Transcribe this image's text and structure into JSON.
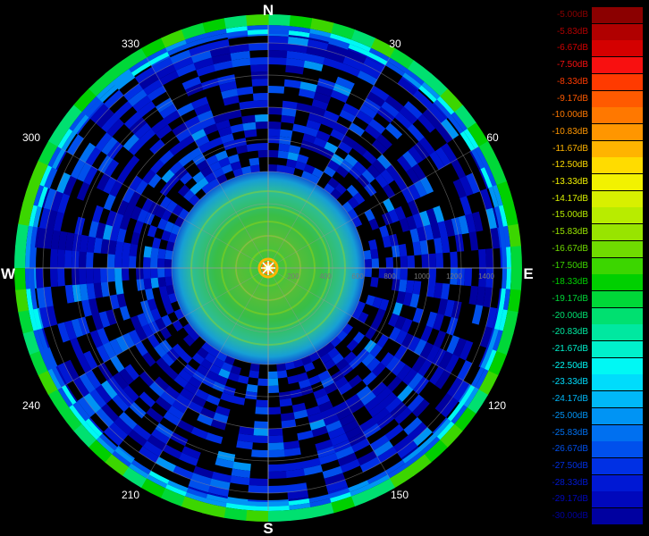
{
  "compass": {
    "north": "N",
    "south": "S",
    "east": "E",
    "west": "W"
  },
  "bearings": [
    "30",
    "60",
    "120",
    "150",
    "210",
    "240",
    "300",
    "330"
  ],
  "range_labels": [
    "200",
    "400",
    "600",
    "800",
    "1000",
    "1200",
    "1400"
  ],
  "colors": {
    "background": "#000000",
    "grid": "#9a9a9a",
    "range_label": "#7a7a7a"
  },
  "legend": {
    "items": [
      {
        "label": "-5.00dB",
        "color": "#8b0000"
      },
      {
        "label": "-5.83dB",
        "color": "#b00000"
      },
      {
        "label": "-6.67dB",
        "color": "#d40000"
      },
      {
        "label": "-7.50dB",
        "color": "#f81010"
      },
      {
        "label": "-8.33dB",
        "color": "#ff3a00"
      },
      {
        "label": "-9.17dB",
        "color": "#ff5a00"
      },
      {
        "label": "-10.00dB",
        "color": "#ff7800"
      },
      {
        "label": "-10.83dB",
        "color": "#ff9600"
      },
      {
        "label": "-11.67dB",
        "color": "#ffb400"
      },
      {
        "label": "-12.50dB",
        "color": "#ffdc00"
      },
      {
        "label": "-13.33dB",
        "color": "#f2f200"
      },
      {
        "label": "-14.17dB",
        "color": "#d8f000"
      },
      {
        "label": "-15.00dB",
        "color": "#b8ec00"
      },
      {
        "label": "-15.83dB",
        "color": "#98e400"
      },
      {
        "label": "-16.67dB",
        "color": "#70dc00"
      },
      {
        "label": "-17.50dB",
        "color": "#3cd600"
      },
      {
        "label": "-18.33dB",
        "color": "#00d000"
      },
      {
        "label": "-19.17dB",
        "color": "#00d838"
      },
      {
        "label": "-20.00dB",
        "color": "#00e070"
      },
      {
        "label": "-20.83dB",
        "color": "#00e8a0"
      },
      {
        "label": "-21.67dB",
        "color": "#00f0cc"
      },
      {
        "label": "-22.50dB",
        "color": "#00f8f4"
      },
      {
        "label": "-23.33dB",
        "color": "#00dcfc"
      },
      {
        "label": "-24.17dB",
        "color": "#00b8f8"
      },
      {
        "label": "-25.00dB",
        "color": "#0094f4"
      },
      {
        "label": "-25.83dB",
        "color": "#0070f0"
      },
      {
        "label": "-26.67dB",
        "color": "#0050ec"
      },
      {
        "label": "-27.50dB",
        "color": "#0030e4"
      },
      {
        "label": "-28.33dB",
        "color": "#0018d4"
      },
      {
        "label": "-29.17dB",
        "color": "#0008bc"
      },
      {
        "label": "-30.00dB",
        "color": "#0000a0"
      }
    ]
  }
}
